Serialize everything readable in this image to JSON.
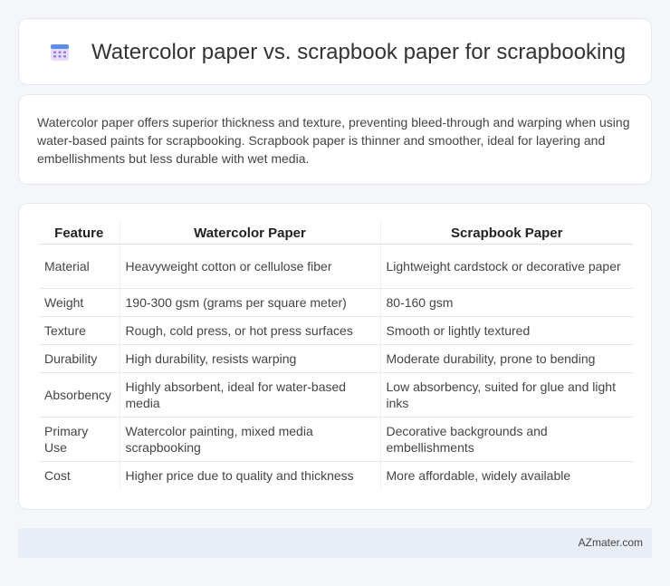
{
  "header": {
    "title": "Watercolor paper vs. scrapbook paper for scrapbooking",
    "icon": "calendar-grid-icon"
  },
  "intro": {
    "text": "Watercolor paper offers superior thickness and texture, preventing bleed-through and warping when using water-based paints for scrapbooking. Scrapbook paper is thinner and smoother, ideal for layering and embellishments but less durable with wet media."
  },
  "table": {
    "headers": [
      "Feature",
      "Watercolor Paper",
      "Scrapbook Paper"
    ],
    "rows": [
      [
        "Material",
        "Heavyweight cotton or cellulose fiber",
        "Lightweight cardstock or decorative paper"
      ],
      [
        "Weight",
        "190-300 gsm (grams per square meter)",
        "80-160 gsm"
      ],
      [
        "Texture",
        "Rough, cold press, or hot press surfaces",
        "Smooth or lightly textured"
      ],
      [
        "Durability",
        "High durability, resists warping",
        "Moderate durability, prone to bending"
      ],
      [
        "Absorbency",
        "Highly absorbent, ideal for water-based media",
        "Low absorbency, suited for glue and light inks"
      ],
      [
        "Primary Use",
        "Watercolor painting, mixed media scrapbooking",
        "Decorative backgrounds and embellishments"
      ],
      [
        "Cost",
        "Higher price due to quality and thickness",
        "More affordable, widely available"
      ]
    ]
  },
  "footer": {
    "brand": "AZmater.com"
  },
  "colors": {
    "icon_top": "#4a7fe0",
    "icon_body": "#d9c8f2",
    "icon_dots": "#9a7fd6"
  }
}
